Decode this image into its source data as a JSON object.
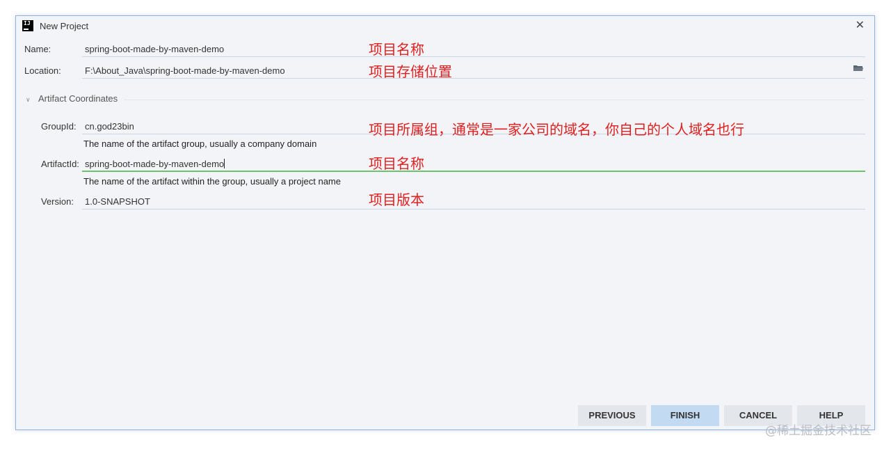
{
  "window": {
    "title": "New Project",
    "close_symbol": "✕"
  },
  "form": {
    "name_label": "Name:",
    "name_value": "spring-boot-made-by-maven-demo",
    "location_label": "Location:",
    "location_value": "F:\\About_Java\\spring-boot-made-by-maven-demo",
    "section_title": "Artifact Coordinates",
    "groupid_label": "GroupId:",
    "groupid_value": "cn.god23bin",
    "groupid_hint": "The name of the artifact group, usually a company domain",
    "artifactid_label": "ArtifactId:",
    "artifactid_value": "spring-boot-made-by-maven-demo",
    "artifactid_hint": "The name of the artifact within the group, usually a project name",
    "version_label": "Version:",
    "version_value": "1.0-SNAPSHOT"
  },
  "annotations": {
    "name": "项目名称",
    "location": "项目存储位置",
    "groupid": "项目所属组，通常是一家公司的域名，你自己的个人域名也行",
    "artifactid": "项目名称",
    "version": "项目版本"
  },
  "buttons": {
    "previous": "PREVIOUS",
    "finish": "FINISH",
    "cancel": "CANCEL",
    "help": "HELP"
  },
  "watermark": "@稀土掘金技术社区",
  "colors": {
    "annotation": "#e02020",
    "active_underline": "#6ec26e",
    "primary_button": "#c2daf2"
  }
}
